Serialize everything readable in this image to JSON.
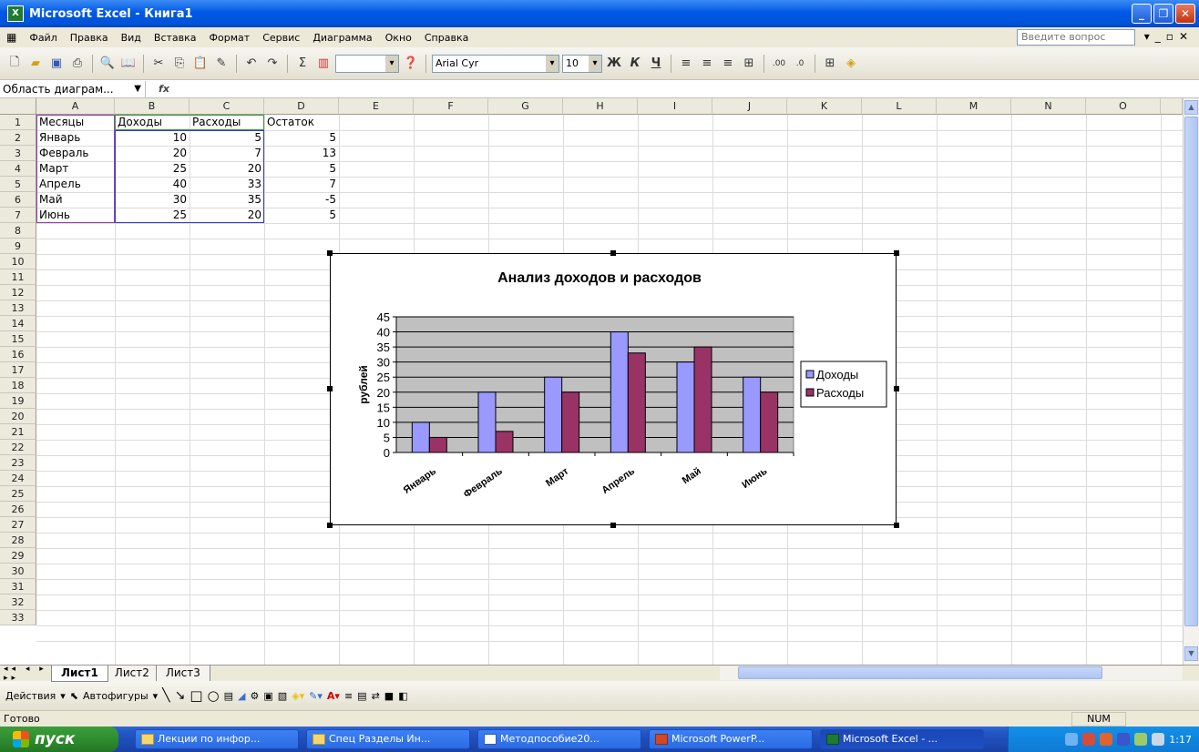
{
  "app": {
    "title": "Microsoft Excel - Книга1"
  },
  "menu": {
    "items": [
      "Файл",
      "Правка",
      "Вид",
      "Вставка",
      "Формат",
      "Сервис",
      "Диаграмма",
      "Окно",
      "Справка"
    ],
    "ask_placeholder": "Введите вопрос"
  },
  "toolbar": {
    "font_name": "Arial Cyr",
    "font_size": "10"
  },
  "formula": {
    "name_box": "Область диаграм...",
    "fx": "fx"
  },
  "sheet": {
    "columns": [
      "A",
      "B",
      "C",
      "D",
      "E",
      "F",
      "G",
      "H",
      "I",
      "J",
      "K",
      "L",
      "M",
      "N",
      "O"
    ],
    "rows": [
      "1",
      "2",
      "3",
      "4",
      "5",
      "6",
      "7",
      "8",
      "9",
      "10",
      "11",
      "12",
      "13",
      "14",
      "15",
      "16",
      "17",
      "18",
      "19",
      "20",
      "21",
      "22",
      "23",
      "24",
      "25",
      "26",
      "27",
      "28",
      "29",
      "30",
      "31",
      "32",
      "33"
    ],
    "headers": [
      "Месяцы",
      "Доходы",
      "Расходы",
      "Остаток"
    ],
    "data": [
      [
        "Январь",
        "10",
        "5",
        "5"
      ],
      [
        "Февраль",
        "20",
        "7",
        "13"
      ],
      [
        "Март",
        "25",
        "20",
        "5"
      ],
      [
        "Апрель",
        "40",
        "33",
        "7"
      ],
      [
        "Май",
        "30",
        "35",
        "-5"
      ],
      [
        "Июнь",
        "25",
        "20",
        "5"
      ]
    ]
  },
  "tabs": [
    "Лист1",
    "Лист2",
    "Лист3"
  ],
  "drawbar": {
    "actions": "Действия",
    "autoshapes": "Автофигуры"
  },
  "status": {
    "ready": "Готово",
    "num": "NUM"
  },
  "taskbar": {
    "start": "пуск",
    "items": [
      "Лекции по инфор...",
      "Спец Разделы Ин...",
      "Методпособие20...",
      "Microsoft PowerP...",
      "Microsoft Excel - ..."
    ],
    "clock": "1:17"
  },
  "colors": {
    "series1": "#9999ff",
    "series2": "#993366",
    "plot_bg": "#c0c0c0"
  },
  "chart_data": {
    "type": "bar",
    "title": "Анализ доходов и расходов",
    "ylabel": "рублей",
    "xlabel": "",
    "categories": [
      "Январь",
      "Февраль",
      "Март",
      "Апрель",
      "Май",
      "Июнь"
    ],
    "series": [
      {
        "name": "Доходы",
        "values": [
          10,
          20,
          25,
          40,
          30,
          25
        ]
      },
      {
        "name": "Расходы",
        "values": [
          5,
          7,
          20,
          33,
          35,
          20
        ]
      }
    ],
    "ylim": [
      0,
      45
    ],
    "yticks": [
      "0",
      "5",
      "10",
      "15",
      "20",
      "25",
      "30",
      "35",
      "40",
      "45"
    ],
    "grid": true,
    "legend": "right"
  }
}
